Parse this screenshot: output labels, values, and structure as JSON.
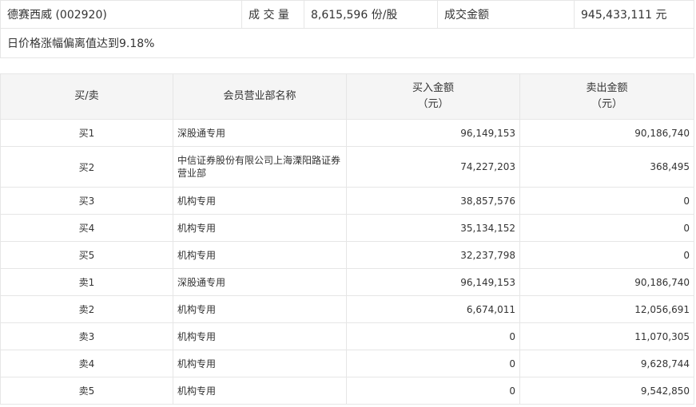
{
  "summary": {
    "stock_name": "德赛西威 (002920)",
    "volume_label": "成 交 量",
    "volume_value": "8,615,596 份/股",
    "amount_label": "成交金额",
    "amount_value": "945,433,111 元",
    "reason": "日价格涨幅偏离值达到9.18%"
  },
  "table": {
    "headers": {
      "side": "买/卖",
      "dept": "会员营业部名称",
      "buy_line1": "买入金额",
      "buy_line2": "（元）",
      "sell_line1": "卖出金额",
      "sell_line2": "（元）"
    },
    "rows": [
      {
        "side": "买1",
        "dept": "深股通专用",
        "buy": "96,149,153",
        "sell": "90,186,740"
      },
      {
        "side": "买2",
        "dept": "中信证券股份有限公司上海溧阳路证券营业部",
        "buy": "74,227,203",
        "sell": "368,495"
      },
      {
        "side": "买3",
        "dept": "机构专用",
        "buy": "38,857,576",
        "sell": "0"
      },
      {
        "side": "买4",
        "dept": "机构专用",
        "buy": "35,134,152",
        "sell": "0"
      },
      {
        "side": "买5",
        "dept": "机构专用",
        "buy": "32,237,798",
        "sell": "0"
      },
      {
        "side": "卖1",
        "dept": "深股通专用",
        "buy": "96,149,153",
        "sell": "90,186,740"
      },
      {
        "side": "卖2",
        "dept": "机构专用",
        "buy": "6,674,011",
        "sell": "12,056,691"
      },
      {
        "side": "卖3",
        "dept": "机构专用",
        "buy": "0",
        "sell": "11,070,305"
      },
      {
        "side": "卖4",
        "dept": "机构专用",
        "buy": "0",
        "sell": "9,628,744"
      },
      {
        "side": "卖5",
        "dept": "机构专用",
        "buy": "0",
        "sell": "9,542,850"
      }
    ]
  }
}
